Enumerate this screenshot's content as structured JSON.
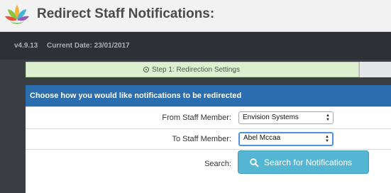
{
  "app": {
    "title": "Redirect Staff Notifications:",
    "version": "v4.9.13",
    "current_date": "Current Date: 23/01/2017"
  },
  "steps": {
    "step1_label": "Step 1: Redirection Settings"
  },
  "panel": {
    "title": "Choose how you would like notifications to be redirected",
    "from_label": "From Staff Member:",
    "from_value": "Envision Systems",
    "to_label": "To Staff Member:",
    "to_value": "Abel Mccaa",
    "search_label": "Search:",
    "search_button": "Search for Notifications"
  },
  "icons": {
    "logo": "lotus-logo-icon",
    "step": "circle-dot-icon",
    "search": "magnifier-icon",
    "select_arrows": "up-down-chevron-icon"
  },
  "colors": {
    "panel_header": "#2b6eb0",
    "step_active": "#dcefd0",
    "search_button": "#55b6d4"
  }
}
